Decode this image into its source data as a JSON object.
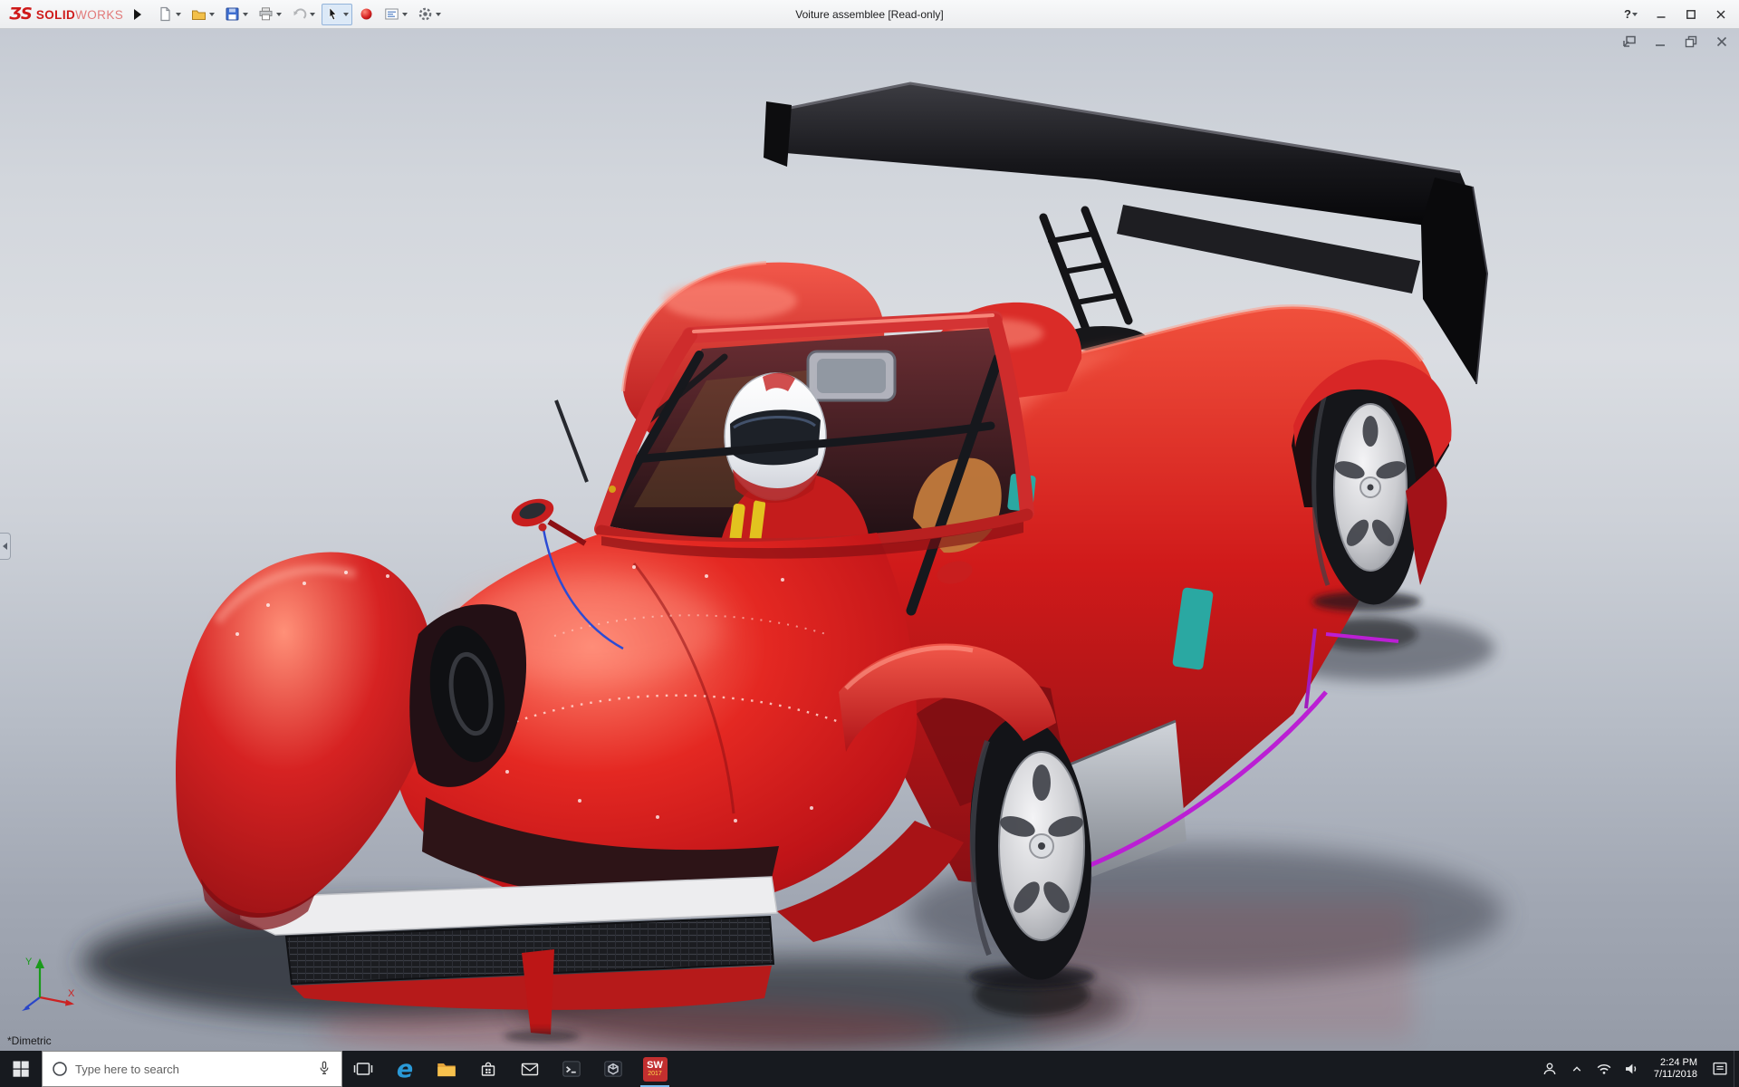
{
  "titlebar": {
    "logo": {
      "prefix": "ƷS",
      "strong": "SOLID",
      "light": "WORKS"
    },
    "document_title": "Voiture assemblee [Read-only]",
    "help_label": "?",
    "toolbar_buttons": [
      "new-document",
      "open",
      "save",
      "print",
      "undo",
      "select-tool",
      "appearance-sphere",
      "drawing-sheet",
      "options-gear"
    ],
    "window_buttons": [
      "minimize",
      "maximize",
      "close"
    ]
  },
  "viewport": {
    "view_orientation_label": "*Dimetric",
    "triad_labels": {
      "x": "X",
      "y": "Y"
    },
    "document_window_buttons": [
      "float",
      "minimize",
      "restore",
      "close"
    ]
  },
  "taskbar": {
    "search": {
      "placeholder": "Type here to search"
    },
    "pinned_apps": [
      "task-view",
      "edge",
      "file-explorer",
      "store",
      "mail",
      "console",
      "3d-viewer",
      "solidworks"
    ],
    "edge_glyph": "e",
    "solidworks_badge": {
      "text": "SW",
      "year": "2017"
    },
    "tray_icons": [
      "people",
      "hidden-icons-chevron",
      "network",
      "volume",
      "action-center"
    ],
    "tray": {
      "time": "2:24 PM",
      "date": "7/11/2018"
    }
  },
  "colors": {
    "car_red": "#d01a1a",
    "wing_black": "#141416",
    "accent_purple": "#bb1fd4",
    "accent_teal": "#2aa8a2",
    "taskbar_bg": "#171a1f",
    "titlebar_bg": "#f2f3f5"
  }
}
